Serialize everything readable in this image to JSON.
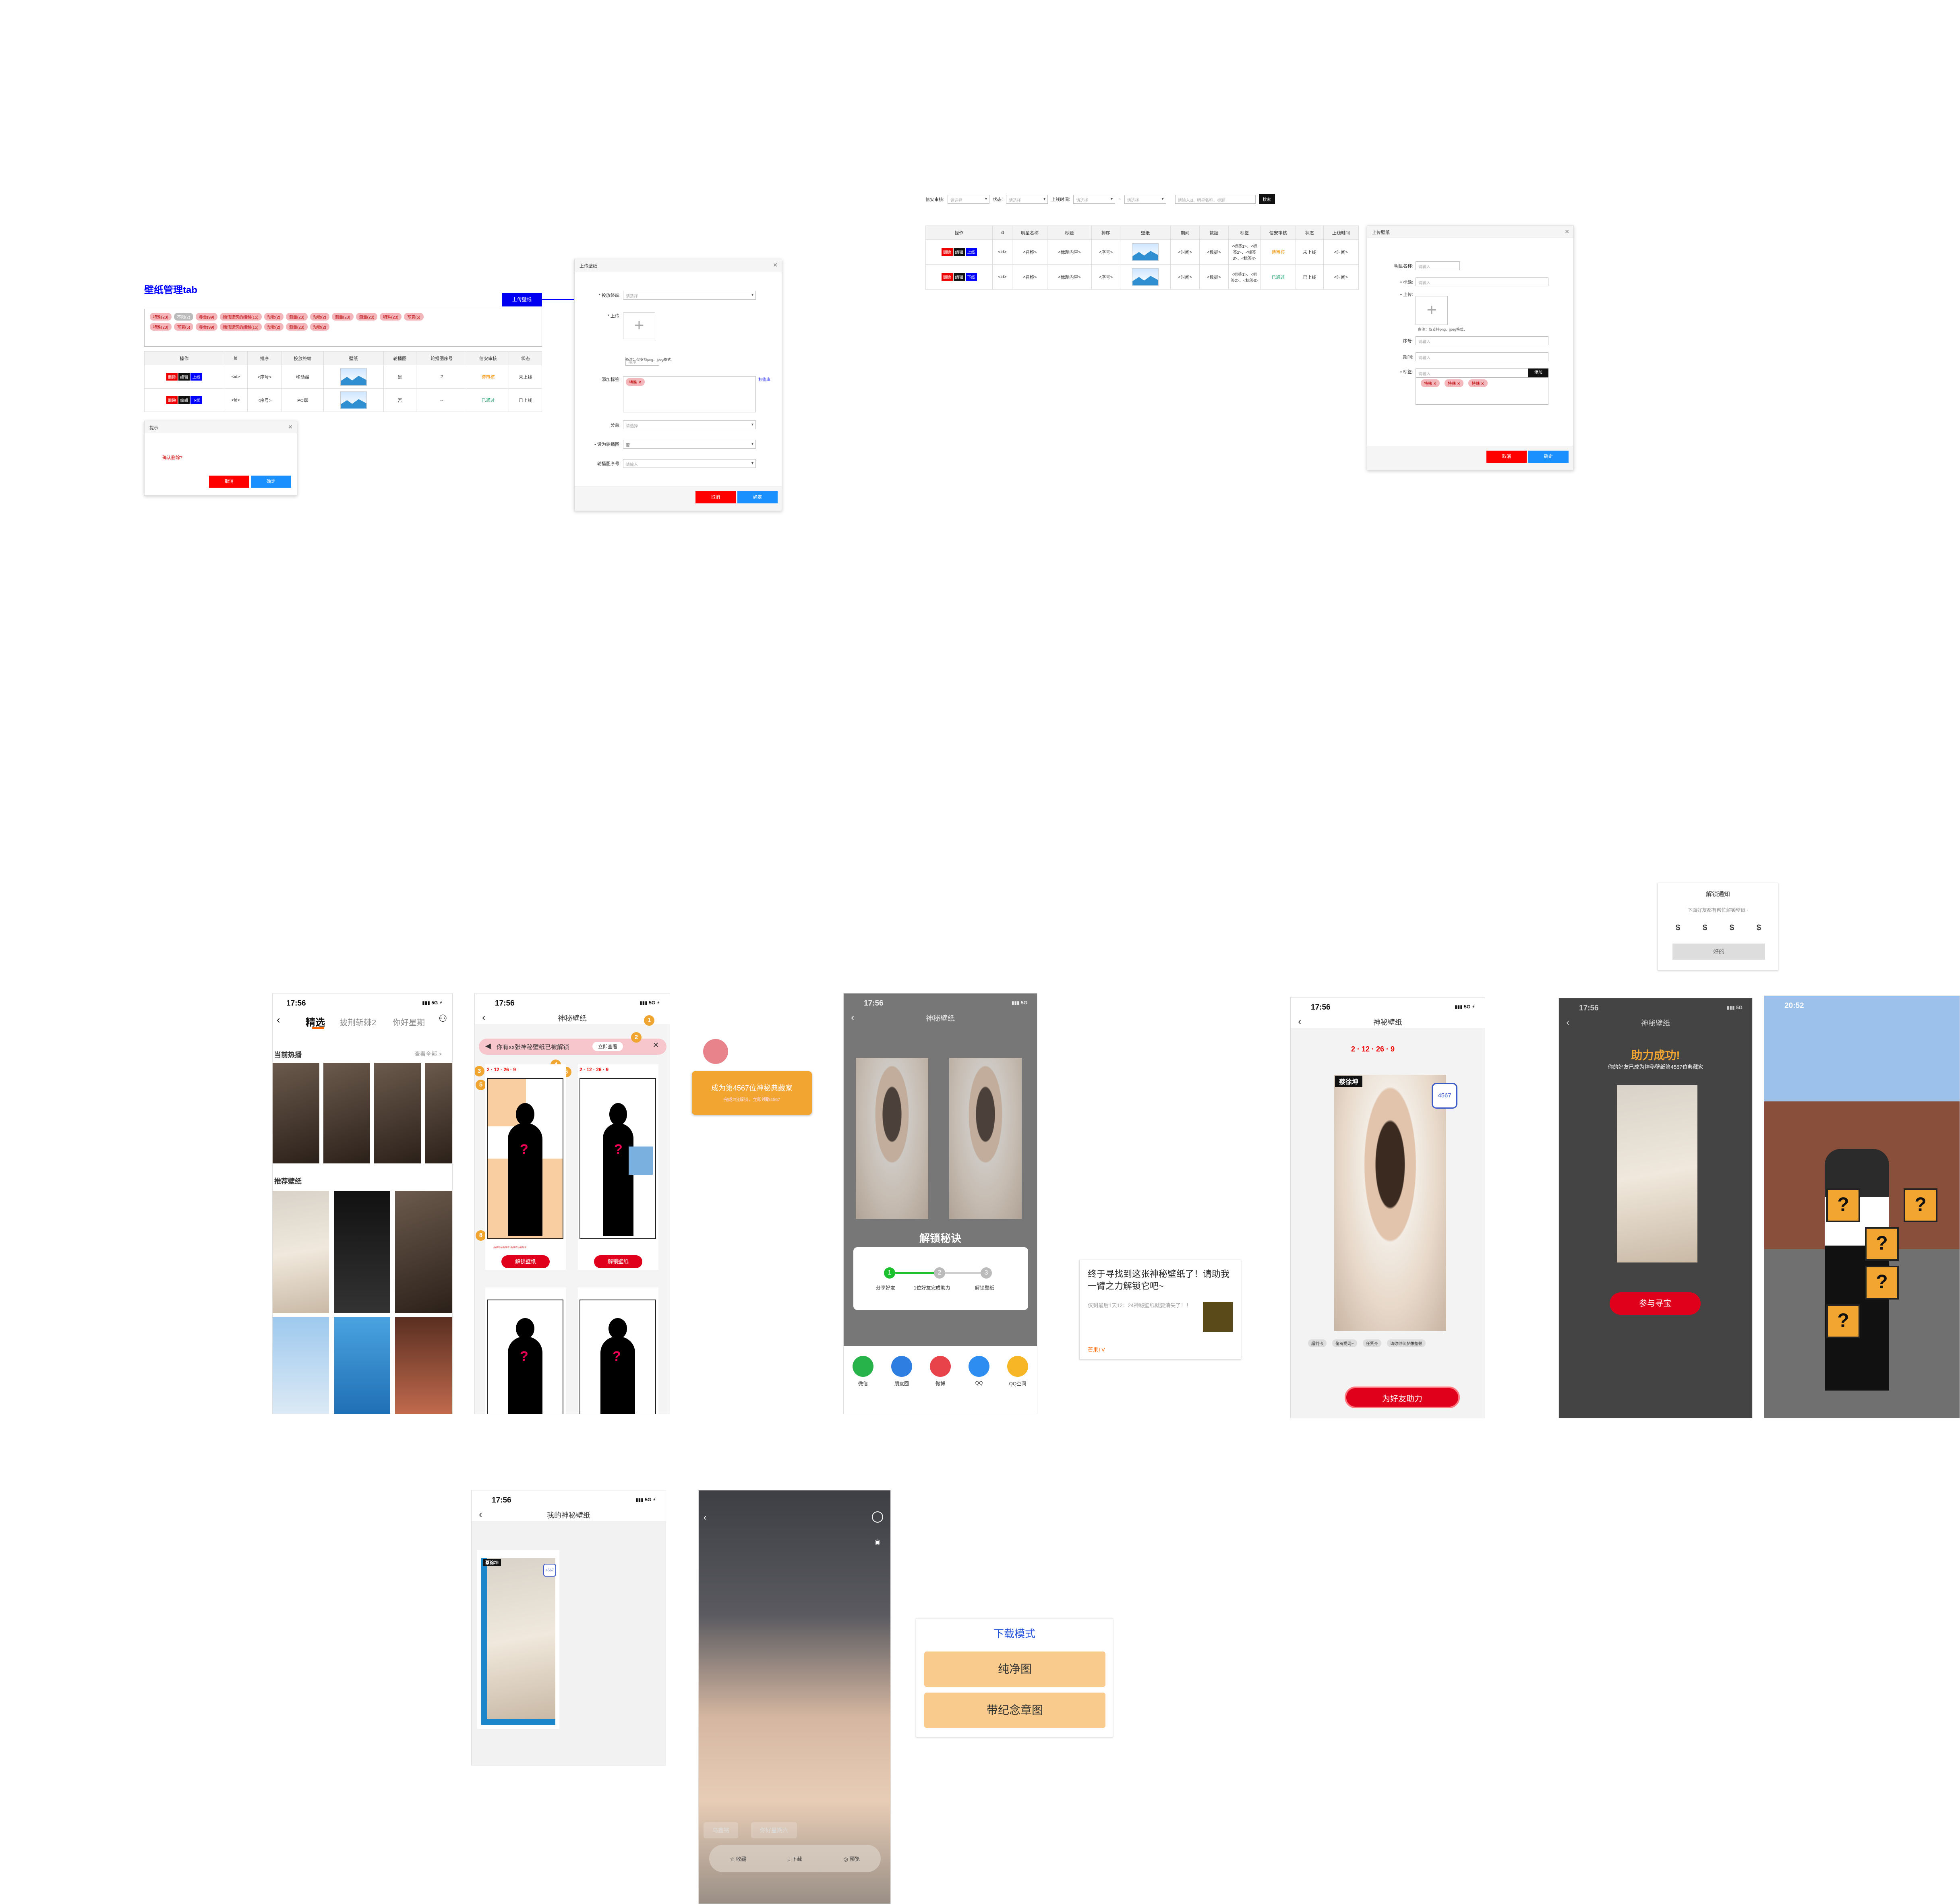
{
  "admin": {
    "title": "壁纸管理tab",
    "upload_btn": "上传壁纸",
    "tags_row1": [
      "特殊(23)",
      "不限(2)",
      "赤金(99)",
      "腾讯建筑的组制(15)",
      "动物(2)",
      "测量(23)",
      "动物(2)",
      "测量(23)",
      "测量(23)",
      "特殊(23)",
      "写真(5)"
    ],
    "tags_row2": [
      "特殊(23)",
      "写真(5)",
      "赤金(99)",
      "腾讯建筑的组制(15)",
      "动物(2)",
      "测量(23)",
      "动物(2)"
    ],
    "table_headers": [
      "操作",
      "id",
      "排序",
      "投放终端",
      "壁纸",
      "轮播图",
      "轮播图序号",
      "信安审核",
      "状态"
    ],
    "rows": [
      {
        "ops": [
          "删除",
          "编辑",
          "上线"
        ],
        "id": "<id>",
        "sort": "<序号>",
        "term": "移动端",
        "carousel": "是",
        "num": "2",
        "audit": "待审核",
        "status": "未上线"
      },
      {
        "ops": [
          "删除",
          "编辑",
          "下线"
        ],
        "id": "<id>",
        "sort": "<序号>",
        "term": "PC端",
        "carousel": "否",
        "num": "--",
        "audit": "已通过",
        "status": "已上线"
      }
    ],
    "confirm": {
      "title": "提示",
      "msg": "确认删除?",
      "cancel": "取消",
      "ok": "确定"
    },
    "upload_dialog": {
      "title": "上传壁纸",
      "f_terminal": "* 投放终端:",
      "ph_select": "请选择",
      "f_upload": "* 上传:",
      "ph_sort": "排序",
      "hint": "备注：仅支持png、jpeg格式，",
      "f_tags": "添加标签:",
      "tag": "特殊",
      "tag_lib": "标签库",
      "f_cat": "分类:",
      "f_carousel": "• 设为轮播图:",
      "carousel_val": "否",
      "f_num": "轮播图序号:",
      "ph_input": "请输入",
      "cancel": "取消",
      "ok": "确定"
    }
  },
  "admin2": {
    "filters": {
      "audit": "信安审核:",
      "status": "状态:",
      "time": "上线时间:",
      "to": "~",
      "ph": "请选择",
      "search_ph": "请输入id、明星名称、标题",
      "search_btn": "搜索"
    },
    "headers": [
      "操作",
      "id",
      "明星名称",
      "标题",
      "排序",
      "壁纸",
      "期间",
      "数据",
      "标签",
      "信安审核",
      "状态",
      "上线时间"
    ],
    "rows": [
      {
        "ops": [
          "删除",
          "编辑",
          "上线"
        ],
        "id": "<id>",
        "star": "<名称>",
        "title": "<标题内容>",
        "sort": "<序号>",
        "period": "<时间>",
        "data": "<数据>",
        "tags": "<标签1>、<标签2>、<标签3>、<标签4>",
        "audit": "待审核",
        "status": "未上线",
        "time": "<时间>"
      },
      {
        "ops": [
          "删除",
          "编辑",
          "下线"
        ],
        "id": "<id>",
        "star": "<名称>",
        "title": "<标题内容>",
        "sort": "<序号>",
        "period": "<时间>",
        "data": "<数据>",
        "tags": "<标签1>、<标签2>、<标签3>",
        "audit": "已通过",
        "status": "已上线",
        "time": "<时间>"
      }
    ],
    "dialog": {
      "title": "上传壁纸",
      "f_star": "明星名称:",
      "f_title": "• 标题:",
      "f_upload": "• 上传:",
      "f_sort": "序号:",
      "f_period": "期间:",
      "f_tags": "• 标签:",
      "ph": "请输入",
      "add": "添加",
      "hint": "备注：仅支持png、jpeg格式，",
      "tags": [
        "特殊",
        "特殊",
        "特殊"
      ],
      "cancel": "取消",
      "ok": "确定"
    }
  },
  "phones": {
    "time": "17:56",
    "time2": "20:52",
    "sig": "5G",
    "p1": {
      "tabs": [
        "精选",
        "披荆斩棘2",
        "你好星期"
      ],
      "hot": "当前热播",
      "more": "查看全部 >",
      "rec": "推荐壁纸"
    },
    "p2": {
      "title": "神秘壁纸",
      "banner": "你有xx张神秘壁纸已被解锁",
      "banner_btn": "立即查看",
      "unlock": "解锁壁纸",
      "badge": "4567"
    },
    "popup": {
      "main": "成为第4567位神秘典藏家",
      "sub": "完成2份解锁，立即领取4567"
    },
    "p3": {
      "title": "神秘壁纸",
      "secret": "解锁秘诀",
      "steps": [
        "分享好友",
        "1位好友完成助力",
        "解锁壁纸"
      ],
      "share": [
        "微信",
        "朋友圈",
        "微博",
        "QQ",
        "QQ空间"
      ]
    },
    "share_card": {
      "text": "终于寻找到这张神秘壁纸了！请助我一臂之力解锁它吧~",
      "sub": "仅剩最后1天12：24神秘壁纸就要消失了！！",
      "brand": "芒果TV"
    },
    "p4": {
      "title": "神秘壁纸",
      "star": "蔡徐坤",
      "badge": "4567",
      "btn": "为好友助力",
      "tags": [
        "超前卡",
        "偷鸡提网~",
        "任贤齐",
        "请你继续梦想整顿"
      ]
    },
    "p5": {
      "title": "神秘壁纸",
      "success": "助力成功!",
      "sub": "你的好友已成为神秘壁纸第4567位典藏家",
      "btn": "参与寻宝"
    },
    "notice": {
      "title": "解锁通知",
      "msg": "下面好友都有帮忙解锁壁纸~",
      "ok": "好的"
    },
    "p7": {
      "title": "我的神秘壁纸",
      "star": "蔡徐坤",
      "badge": "4567"
    },
    "p8": {
      "chip1": "乌鑫铭",
      "chip2": "你好星期六",
      "bar": [
        "收藏",
        "下载",
        "预览"
      ]
    },
    "dl": {
      "title": "下载模式",
      "opt1": "纯净图",
      "opt2": "带纪念章图"
    }
  },
  "colors": {
    "accent": "#00f",
    "red": "#e00",
    "orange": "#f3a531",
    "blue_btn": "#1890ff"
  }
}
